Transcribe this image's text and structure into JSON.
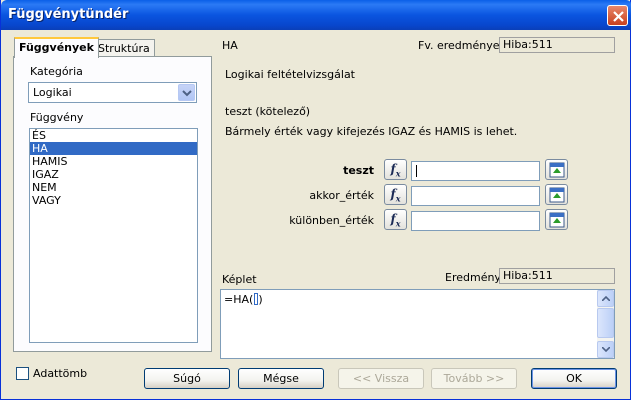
{
  "window": {
    "title": "Függvénytündér"
  },
  "tabs": [
    {
      "label": "Függvények",
      "active": true
    },
    {
      "label": "Struktúra",
      "active": false
    }
  ],
  "category": {
    "label": "Kategória",
    "value": "Logikai"
  },
  "functions": {
    "label": "Függvény",
    "items": [
      "ÉS",
      "HA",
      "HAMIS",
      "IGAZ",
      "NEM",
      "VAGY"
    ],
    "selected": "HA"
  },
  "function_info": {
    "name": "HA",
    "result_label": "Fv. eredménye:",
    "result_value": "Hiba:511",
    "description": "Logikai feltételvizsgálat",
    "arg_title": "teszt (kötelező)",
    "arg_description": "Bármely érték vagy kifejezés IGAZ és HAMIS is lehet."
  },
  "arguments": [
    {
      "label": "teszt",
      "bold": true,
      "value": ""
    },
    {
      "label": "akkor_érték",
      "bold": false,
      "value": ""
    },
    {
      "label": "különben_érték",
      "bold": false,
      "value": ""
    }
  ],
  "formula": {
    "label": "Képlet",
    "result_label": "Eredmény",
    "result_value": "Hiba:511",
    "text": "=HA("
  },
  "array": {
    "label": "Adattömb",
    "checked": false
  },
  "buttons": {
    "help": "Súgó",
    "cancel": "Mégse",
    "back": "<< Vissza",
    "next": "Tovább >>",
    "ok": "OK"
  },
  "icons": {
    "fx": "function-wizard-icon",
    "shrink": "shrink-dialog-icon",
    "close": "close-icon"
  },
  "colors": {
    "titlebar": "#0a55e0",
    "selection": "#316ac5",
    "dialog_bg": "#ece9d8"
  }
}
